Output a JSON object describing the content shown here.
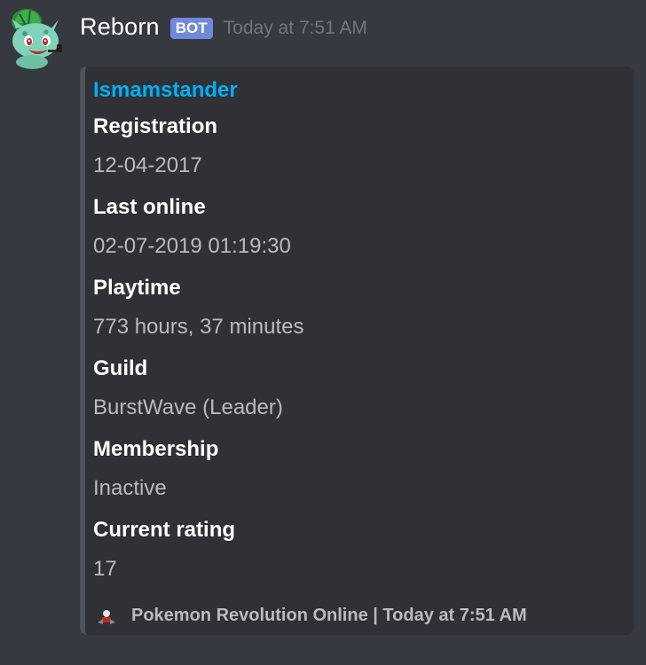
{
  "message": {
    "username": "Reborn",
    "bot_tag": "BOT",
    "timestamp": "Today at 7:51 AM",
    "avatar_icon": "bulbasaur-avatar-icon"
  },
  "embed": {
    "title": "Ismamstander",
    "accent_color": "#4f545c",
    "title_color": "#00b0f4",
    "fields": [
      {
        "name": "Registration",
        "value": "12-04-2017"
      },
      {
        "name": "Last online",
        "value": "02-07-2019 01:19:30"
      },
      {
        "name": "Playtime",
        "value": "773 hours, 37 minutes"
      },
      {
        "name": "Guild",
        "value": "BurstWave (Leader)"
      },
      {
        "name": "Membership",
        "value": "Inactive"
      },
      {
        "name": "Current rating",
        "value": "17"
      }
    ],
    "footer": {
      "text": "Pokemon Revolution Online | Today at 7:51 AM",
      "icon": "pokemon-revolution-logo-icon"
    }
  },
  "colors": {
    "background": "#36393f",
    "embed_background": "#2f3136",
    "bot_tag": "#7289da"
  }
}
